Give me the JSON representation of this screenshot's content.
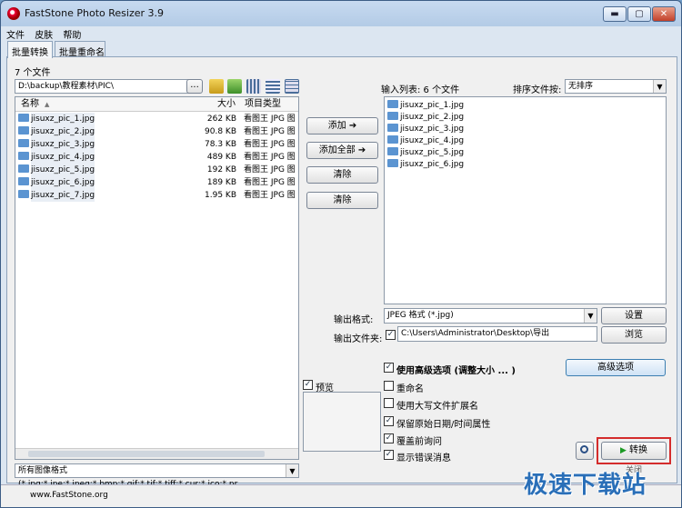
{
  "window": {
    "title": "FastStone Photo Resizer 3.9",
    "min": "▬",
    "max": "▢",
    "close": "✕"
  },
  "menu": [
    "文件",
    "皮肤",
    "帮助"
  ],
  "tabs": [
    "批量转换",
    "批量重命名"
  ],
  "left": {
    "count_label": "7 个文件",
    "path": "D:\\backup\\教程素材\\PIC\\",
    "browse": "...",
    "columns": {
      "name": "名称",
      "size": "大小",
      "type": "项目类型"
    },
    "files": [
      {
        "name": "jisuxz_pic_1.jpg",
        "size": "262 KB",
        "type": "看图王 JPG 图"
      },
      {
        "name": "jisuxz_pic_2.jpg",
        "size": "90.8 KB",
        "type": "看图王 JPG 图"
      },
      {
        "name": "jisuxz_pic_3.jpg",
        "size": "78.3 KB",
        "type": "看图王 JPG 图"
      },
      {
        "name": "jisuxz_pic_4.jpg",
        "size": "489 KB",
        "type": "看图王 JPG 图"
      },
      {
        "name": "jisuxz_pic_5.jpg",
        "size": "192 KB",
        "type": "看图王 JPG 图"
      },
      {
        "name": "jisuxz_pic_6.jpg",
        "size": "189 KB",
        "type": "看图王 JPG 图"
      },
      {
        "name": "jisuxz_pic_7.jpg",
        "size": "1.95 KB",
        "type": "看图王 JPG 图"
      }
    ],
    "filter": "所有图像格式 (*.jpg;*.jpe;*.jpeg;*.bmp;*.gif;*.tif;*.tiff;*.cur;*.ico;*.pr"
  },
  "middle": {
    "add": "添加 ➔",
    "add_all": "添加全部 ➔",
    "remove": "清除",
    "clear": "清除"
  },
  "right": {
    "input_label": "输入列表: 6 个文件",
    "sort_label": "排序文件按:",
    "sort_value": "无排序",
    "files": [
      "jisuxz_pic_1.jpg",
      "jisuxz_pic_2.jpg",
      "jisuxz_pic_3.jpg",
      "jisuxz_pic_4.jpg",
      "jisuxz_pic_5.jpg",
      "jisuxz_pic_6.jpg"
    ]
  },
  "output": {
    "format_label": "输出格式:",
    "format_value": "JPEG 格式 (*.jpg)",
    "settings": "设置",
    "folder_label": "输出文件夹:",
    "folder_value": "C:\\Users\\Administrator\\Desktop\\导出",
    "browse": "浏览"
  },
  "options": {
    "preview": "预览",
    "advanced": "使用高级选项 (调整大小 ... )",
    "advanced_button": "高级选项",
    "rename": "重命名",
    "uppercase_ext": "使用大写文件扩展名",
    "keep_date": "保留原始日期/时间属性",
    "ask_overwrite": "覆盖前询问",
    "show_errors": "显示错误消息",
    "convert": "转换",
    "close_partial": "关闭"
  },
  "status": {
    "url": "www.FastStone.org"
  },
  "watermark": "极速下载站"
}
